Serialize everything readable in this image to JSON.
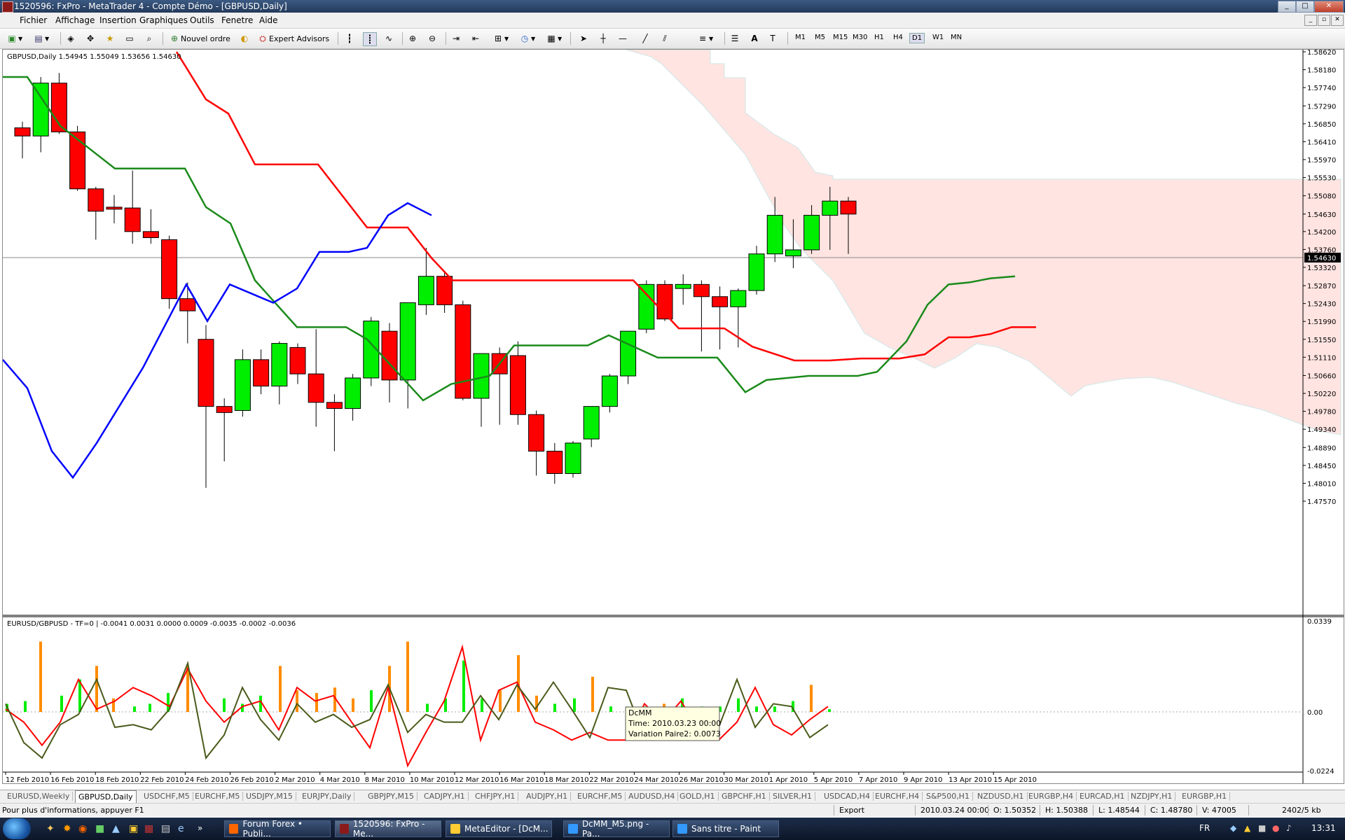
{
  "window": {
    "title": "1520596: FxPro - MetaTrader 4 - Compte Démo - [GBPUSD,Daily]",
    "buttons": {
      "minimize": "_",
      "maximize": "□",
      "close": "✕"
    }
  },
  "menu": {
    "items": [
      "Fichier",
      "Affichage",
      "Insertion",
      "Graphiques",
      "Outils",
      "Fenetre",
      "Aide"
    ],
    "mdi_buttons": [
      "_",
      "▫",
      "✕"
    ]
  },
  "toolbar": {
    "new_order_label": "Nouvel ordre",
    "expert_advisors_label": "Expert Advisors",
    "timeframes": [
      "M1",
      "M5",
      "M15",
      "M30",
      "H1",
      "H4",
      "D1",
      "W1",
      "MN"
    ],
    "active_timeframe": "D1"
  },
  "chart": {
    "header": "GBPUSD,Daily  1.54945 1.55049 1.53656 1.54630",
    "current_price_label": "1.54630",
    "price_ticks": [
      "1.58620",
      "1.58180",
      "1.57740",
      "1.57290",
      "1.56850",
      "1.56410",
      "1.55970",
      "1.55530",
      "1.55080",
      "1.54630",
      "1.54200",
      "1.53760",
      "1.53320",
      "1.52870",
      "1.52430",
      "1.51990",
      "1.51550",
      "1.51110",
      "1.50660",
      "1.50220",
      "1.49780",
      "1.49340",
      "1.48890",
      "1.48450",
      "1.48010",
      "1.47570"
    ],
    "date_labels": [
      "12 Feb 2010",
      "16 Feb 2010",
      "18 Feb 2010",
      "22 Feb 2010",
      "24 Feb 2010",
      "26 Feb 2010",
      "2 Mar 2010",
      "4 Mar 2010",
      "8 Mar 2010",
      "10 Mar 2010",
      "12 Mar 2010",
      "16 Mar 2010",
      "18 Mar 2010",
      "22 Mar 2010",
      "24 Mar 2010",
      "26 Mar 2010",
      "30 Mar 2010",
      "1 Apr 2010",
      "5 Apr 2010",
      "7 Apr 2010",
      "9 Apr 2010",
      "13 Apr 2010",
      "15 Apr 2010"
    ],
    "colors": {
      "bull": "#00ee00",
      "bear": "#ff0000",
      "tenkan": "#ff0000",
      "kijun": "#1a8a1a",
      "chikou": "#0000ff",
      "cloud": "#ffe4e1",
      "orange": "#ff8c00"
    }
  },
  "indicator": {
    "header": "EURUSD/GBPUSD - TF=0   | -0.0041 0.0031 0.0000 0.0009 -0.0035 -0.0002 -0.0036",
    "ticks": [
      "0.0339",
      "0.00",
      "-0.0224"
    ],
    "tooltip": {
      "line1": "DcMM",
      "line2": "Time: 2010.03.23 00:00",
      "line3": "Variation Paire2: 0.0073"
    }
  },
  "tabs": [
    "EURUSD,Weekly",
    "GBPUSD,Daily",
    "USDCHF,M5",
    "EURCHF,M5",
    "USDJPY,M15",
    "EURJPY,Daily",
    "GBPJPY,M15",
    "CADJPY,H1",
    "CHFJPY,H1",
    "AUDJPY,H1",
    "EURCHF,M5",
    "AUDUSD,H4",
    "GOLD,H1",
    "GBPCHF,H1",
    "SILVER,H1",
    "USDCAD,H4",
    "EURCHF,H4",
    "S&P500,H1",
    "NZDUSD,H1",
    "EURGBP,H4",
    "EURCAD,H1",
    "NZDJPY,H1",
    "EURGBP,H1"
  ],
  "active_tab": "GBPUSD,Daily",
  "status": {
    "help": "Pour plus d'informations, appuyer F1",
    "profile": "Export",
    "time": "2010.03.24 00:00",
    "open": "O: 1.50352",
    "high": "H: 1.50388",
    "low": "L: 1.48544",
    "close": "C: 1.48780",
    "volume": "V: 47005",
    "traffic": "2402/5 kb"
  },
  "taskbar": {
    "items": [
      "Forum Forex • Publi...",
      "1520596: FxPro - Me...",
      "MetaEditor - [DcM...",
      "DcMM_M5.png - Pa...",
      "Sans titre - Paint"
    ],
    "language": "FR",
    "clock": "13:31"
  }
}
